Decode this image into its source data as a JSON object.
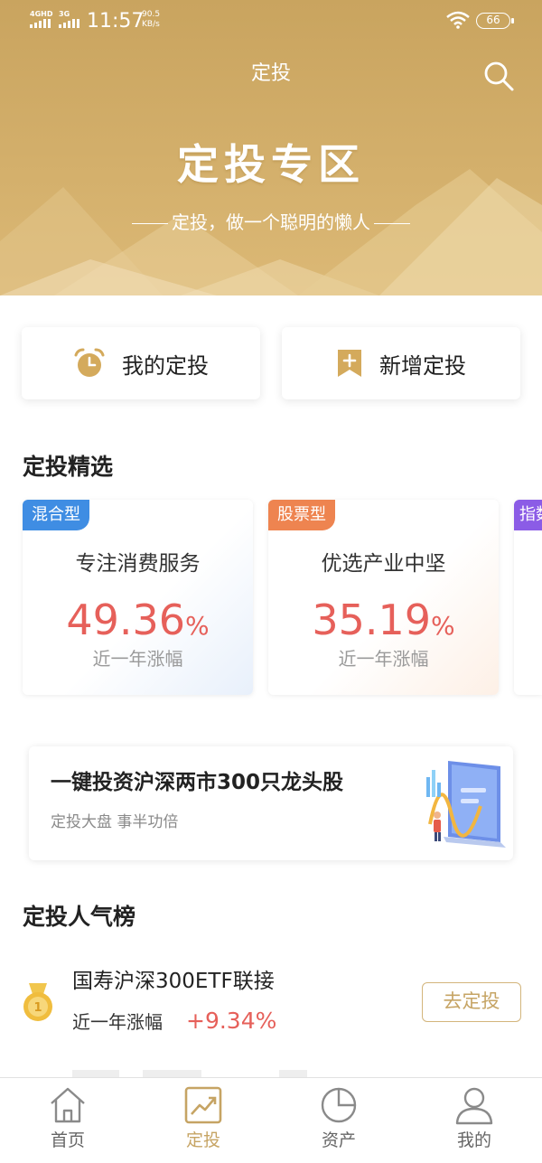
{
  "status_bar": {
    "network1": "4GHD",
    "network2": "3G",
    "time": "11:57",
    "speed_value": "90.5",
    "speed_unit": "KB/s",
    "battery": "66"
  },
  "header": {
    "title": "定投",
    "search_icon": "search-icon"
  },
  "hero": {
    "title": "定投专区",
    "subtitle": "定投，做一个聪明的懒人"
  },
  "actions": {
    "my_invest": {
      "label": "我的定投",
      "icon": "alarm-clock-icon"
    },
    "new_invest": {
      "label": "新增定投",
      "icon": "bookmark-plus-icon"
    }
  },
  "featured": {
    "title": "定投精选",
    "cards": [
      {
        "tag": "混合型",
        "tag_color": "#3f8de3",
        "name": "专注消费服务",
        "rate": "49.36",
        "rate_unit": "%",
        "rate_label": "近一年涨幅"
      },
      {
        "tag": "股票型",
        "tag_color": "#ee8450",
        "name": "优选产业中坚",
        "rate": "35.19",
        "rate_unit": "%",
        "rate_label": "近一年涨幅"
      },
      {
        "tag": "指数型",
        "tag_color": "#8b5ce6"
      }
    ]
  },
  "promo": {
    "title": "一键投资沪深两市300只龙头股",
    "subtitle": "定投大盘 事半功倍"
  },
  "popular": {
    "title": "定投人气榜",
    "items": [
      {
        "name": "国寿沪深300ETF联接",
        "rate_label": "近一年涨幅",
        "rate": "+9.34%",
        "button": "去定投",
        "medal_icon": "gold-medal-icon"
      }
    ]
  },
  "tabbar": {
    "tabs": [
      {
        "label": "首页",
        "icon": "home-icon",
        "active": false
      },
      {
        "label": "定投",
        "icon": "trend-chart-icon",
        "active": true
      },
      {
        "label": "资产",
        "icon": "pie-chart-icon",
        "active": false
      },
      {
        "label": "我的",
        "icon": "person-icon",
        "active": false
      }
    ]
  },
  "colors": {
    "brand_gold": "#c6a464",
    "rate_red": "#e6605a"
  }
}
